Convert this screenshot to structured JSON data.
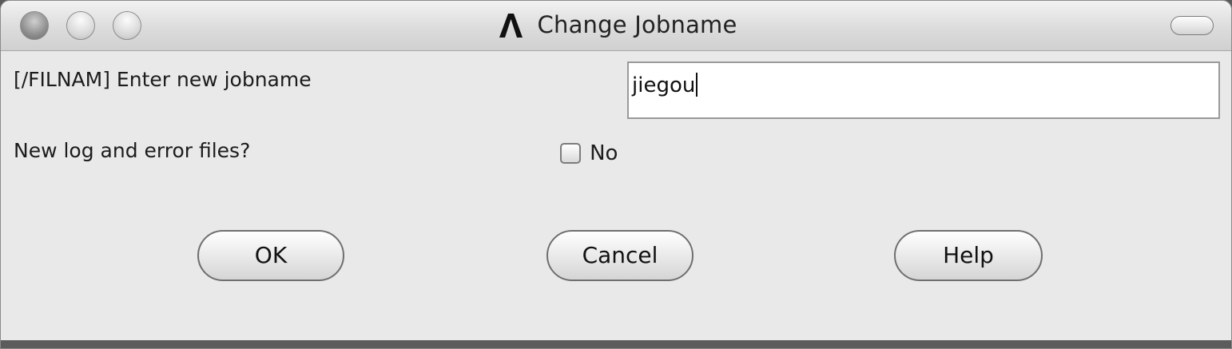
{
  "window": {
    "title": "Change Jobname",
    "app_icon": "ansys-logo-icon"
  },
  "form": {
    "jobname_label": "[/FILNAM] Enter new jobname",
    "jobname_value": "jiegou",
    "log_label": "New log and error files?",
    "log_checkbox_label": "No",
    "log_checkbox_checked": false
  },
  "buttons": {
    "ok": "OK",
    "cancel": "Cancel",
    "help": "Help"
  },
  "colors": {
    "window_bg": "#e9e9e9",
    "title_text": "#222222"
  }
}
